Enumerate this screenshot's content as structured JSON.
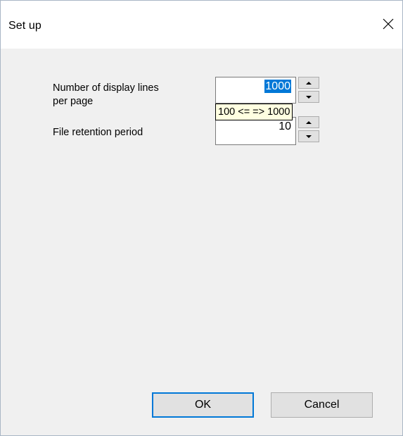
{
  "window": {
    "title": "Set up"
  },
  "form": {
    "display_lines": {
      "label": "Number of display lines\nper page",
      "value": "1000",
      "tooltip": "100 <= => 1000"
    },
    "retention": {
      "label": "File retention period",
      "value": "10"
    }
  },
  "buttons": {
    "ok_label": "OK",
    "cancel_label": "Cancel"
  },
  "icons": {
    "close": "close-icon",
    "spin_up": "arrow-up-icon",
    "spin_down": "arrow-down-icon"
  },
  "colors": {
    "selection": "#0078d7",
    "tooltip_bg": "#ffffe1",
    "dialog_bg": "#f0f0f0"
  }
}
